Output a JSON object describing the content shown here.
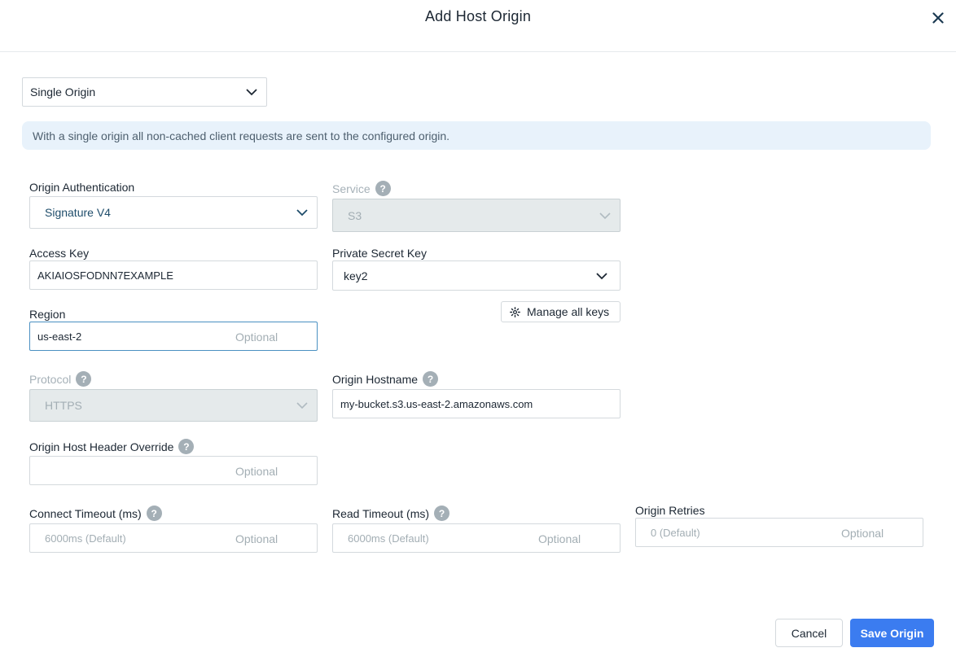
{
  "dialog": {
    "title": "Add Host Origin"
  },
  "origin_type": {
    "selected": "Single Origin"
  },
  "info_banner": {
    "text": "With a single origin all non-cached client requests are sent to the configured origin."
  },
  "origin_auth": {
    "label": "Origin Authentication",
    "selected": "Signature V4"
  },
  "service": {
    "label": "Service",
    "selected": "S3",
    "disabled": true
  },
  "access_key": {
    "label": "Access Key",
    "value": "AKIAIOSFODNN7EXAMPLE"
  },
  "private_secret_key": {
    "label": "Private Secret Key",
    "selected": "key2"
  },
  "manage_keys": {
    "label": "Manage all keys"
  },
  "region": {
    "label": "Region",
    "value": "us-east-2",
    "hint": "Optional"
  },
  "protocol": {
    "label": "Protocol",
    "selected": "HTTPS",
    "disabled": true
  },
  "origin_hostname": {
    "label": "Origin Hostname",
    "value": "my-bucket.s3.us-east-2.amazonaws.com"
  },
  "host_header_override": {
    "label": "Origin Host Header Override",
    "value": "",
    "hint": "Optional"
  },
  "connect_timeout": {
    "label": "Connect Timeout (ms)",
    "placeholder": "6000ms (Default)",
    "hint": "Optional"
  },
  "read_timeout": {
    "label": "Read Timeout (ms)",
    "placeholder": "6000ms (Default)",
    "hint": "Optional"
  },
  "origin_retries": {
    "label": "Origin Retries",
    "placeholder": "0 (Default)",
    "hint": "Optional"
  },
  "footer": {
    "cancel_label": "Cancel",
    "save_label": "Save Origin"
  },
  "icons": {
    "close": "close-icon",
    "chevron": "chevron-down-icon",
    "help": "help-icon",
    "gear": "gear-icon"
  },
  "colors": {
    "primary": "#3b7cf0",
    "banner_bg": "#e8f2fb",
    "focus_border": "#4a90c2",
    "help_icon": "#a4afb6"
  }
}
